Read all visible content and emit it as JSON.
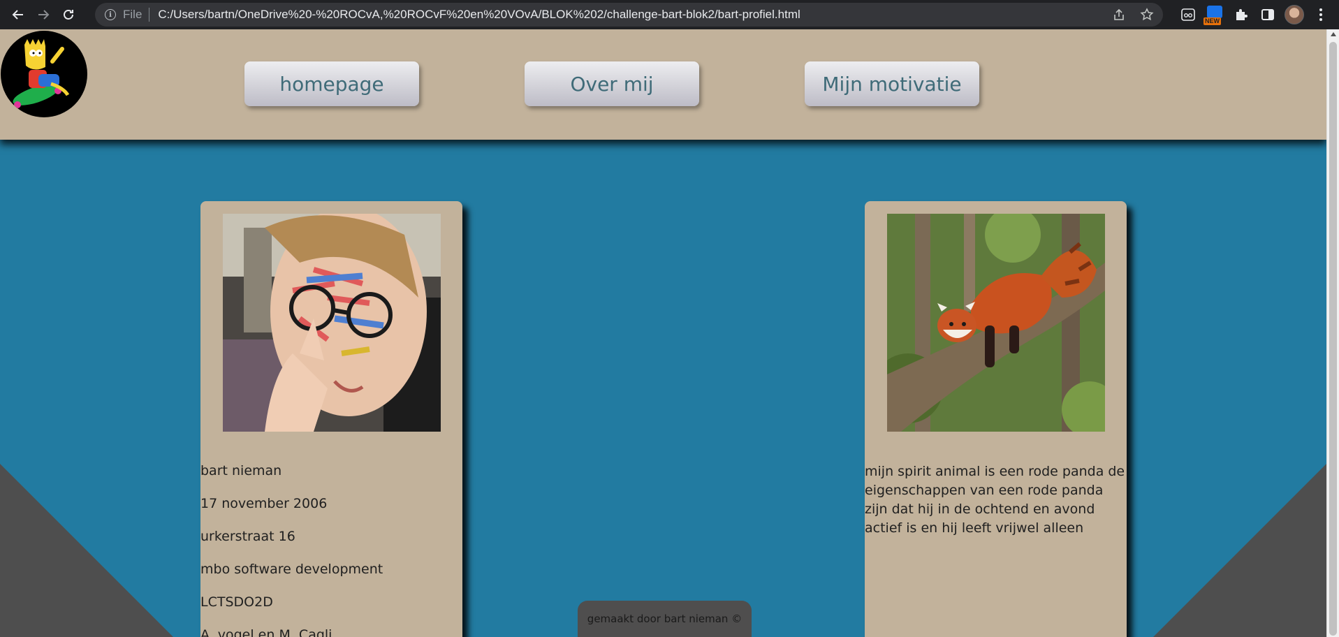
{
  "browser": {
    "back_icon": "arrow-left-icon",
    "forward_icon": "arrow-right-icon",
    "reload_icon": "reload-icon",
    "scheme_label": "File",
    "url": "C:/Users/bartn/OneDrive%20-%20ROCvA,%20ROCvF%20en%20VOvA/BLOK%202/challenge-bart-blok2/bart-profiel.html",
    "new_badge": "NEW"
  },
  "header": {
    "logo_alt": "Bart Simpson logo",
    "nav": [
      {
        "label": "homepage"
      },
      {
        "label": "Over mij"
      },
      {
        "label": "Mijn motivatie"
      }
    ]
  },
  "profile_card": {
    "photo_alt": "foto van bart",
    "lines": [
      "bart nieman",
      "17 november 2006",
      "urkerstraat 16",
      "mbo software development",
      "LCTSDO2D",
      "A. vogel en M. Cagli"
    ]
  },
  "spirit_card": {
    "photo_alt": "rode panda",
    "text": "mijn spirit animal is een rode panda de eigenschappen van een rode panda zijn dat hij in de ochtend en avond actief is en hij leeft vrijwel alleen"
  },
  "footer": {
    "text": "gemaakt door bart nieman ©"
  },
  "colors": {
    "page_bg": "#227ba1",
    "header_bg": "#c2b29b",
    "card_bg": "#c2b29b",
    "corner": "#4e4e4e",
    "nav_text": "#3f6b78",
    "footer_bg": "#4f4e4e"
  }
}
